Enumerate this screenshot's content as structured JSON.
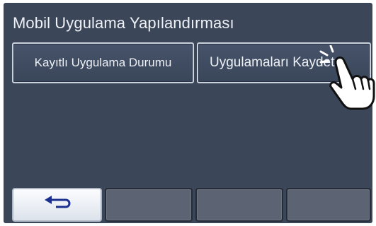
{
  "screen": {
    "title": "Mobil Uygulama Yapılandırması"
  },
  "buttons": {
    "registered_status": "Kayıtlı Uygulama Durumu",
    "register_apps": "Uygulamaları Kaydet"
  },
  "bottom_bar": {
    "back_icon": "back-arrow-icon"
  },
  "colors": {
    "screen_bg": "#3b4659",
    "button_border": "#c9d1dd",
    "bottom_blank": "#5c6373",
    "text": "#eef1f6"
  }
}
